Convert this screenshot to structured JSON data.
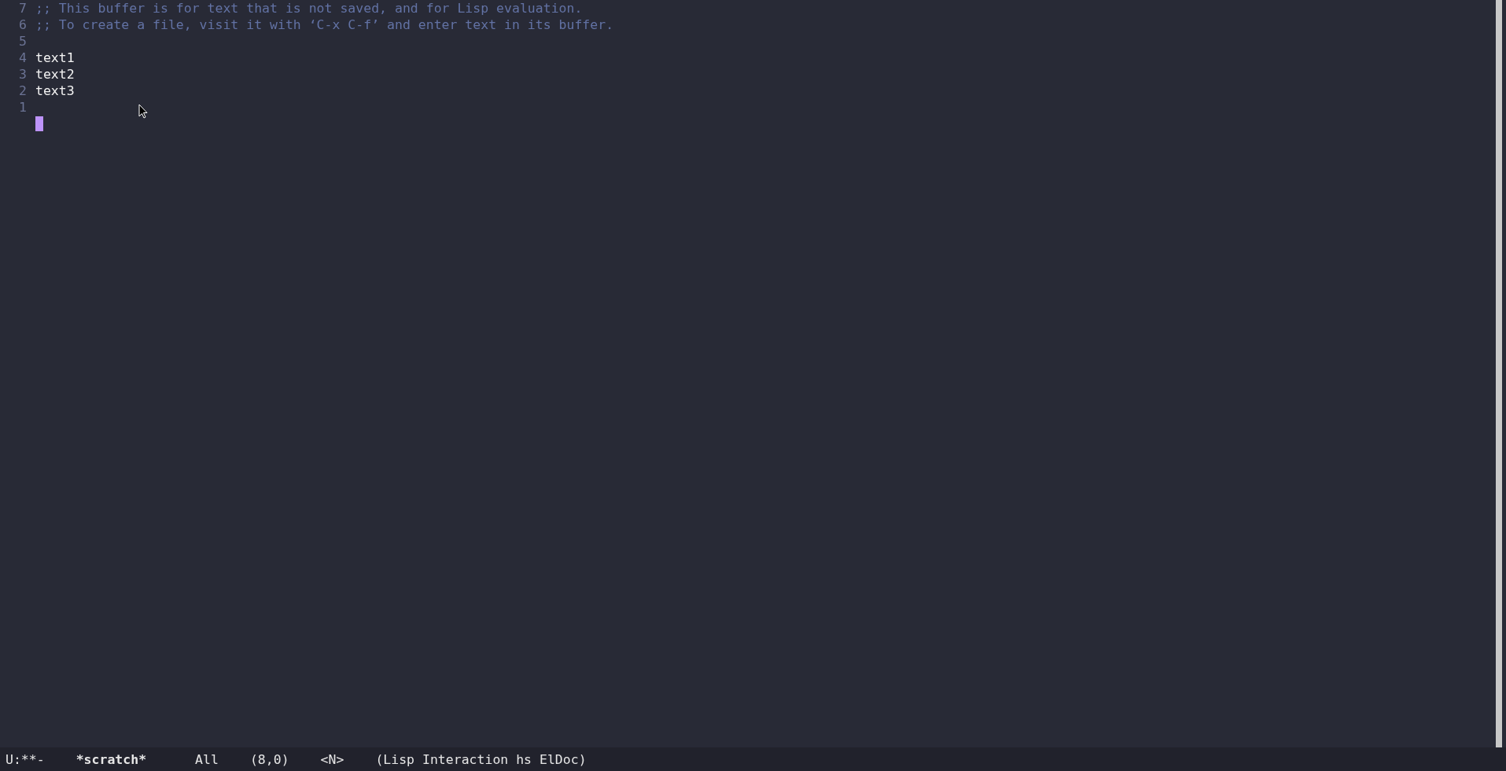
{
  "editor": {
    "lines": [
      {
        "number": "7",
        "text": ";; This buffer is for text that is not saved, and for Lisp evaluation.",
        "kind": "comment"
      },
      {
        "number": "6",
        "text": ";; To create a file, visit it with ‘C-x C-f’ and enter text in its buffer.",
        "kind": "comment"
      },
      {
        "number": "5",
        "kind": "code"
      },
      {
        "number": "4",
        "text": "text1",
        "kind": "code"
      },
      {
        "number": "3",
        "text": "text2",
        "kind": "code"
      },
      {
        "number": "2",
        "text": "text3",
        "kind": "code"
      },
      {
        "number": "1",
        "kind": "code"
      },
      {
        "kind": "cursor"
      }
    ]
  },
  "mode_line": {
    "state": "U:**-",
    "buffer": "*scratch*",
    "position": "All",
    "cursor": "(8,0)",
    "evil_state": "<N>",
    "modes": "(Lisp Interaction hs ElDoc)"
  }
}
